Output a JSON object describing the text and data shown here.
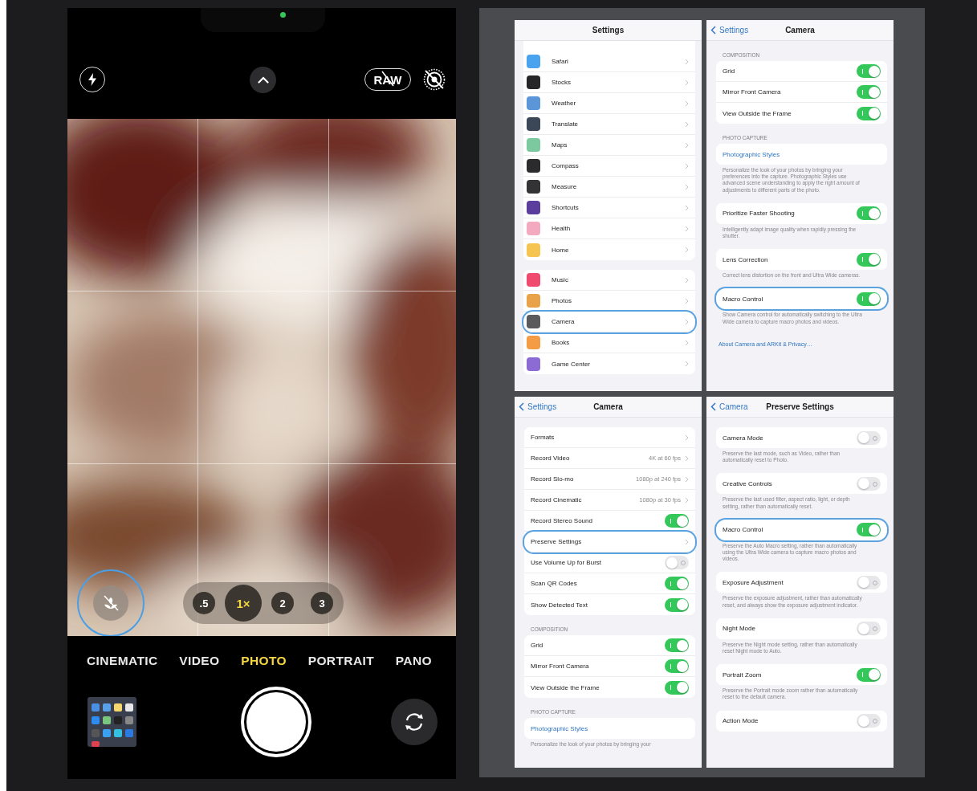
{
  "camera": {
    "raw_label": "RAW",
    "macro_highlighted": true,
    "zoom": [
      {
        "label": ".5",
        "selected": false
      },
      {
        "label": "1×",
        "selected": true
      },
      {
        "label": "2",
        "selected": false
      },
      {
        "label": "3",
        "selected": false
      }
    ],
    "modes": [
      {
        "label": "CINEMATIC",
        "selected": false
      },
      {
        "label": "VIDEO",
        "selected": false
      },
      {
        "label": "PHOTO",
        "selected": true
      },
      {
        "label": "PORTRAIT",
        "selected": false
      },
      {
        "label": "PANO",
        "selected": false
      }
    ]
  },
  "panels": [
    {
      "title": "Settings",
      "groups": [
        {
          "rows": [
            {
              "kind": "app",
              "label": "Safari",
              "color": "#4aa3ee",
              "highlighted": false
            },
            {
              "kind": "app",
              "label": "Stocks",
              "color": "#262628",
              "highlighted": false
            },
            {
              "kind": "app",
              "label": "Weather",
              "color": "#5b97d8",
              "highlighted": false
            },
            {
              "kind": "app",
              "label": "Translate",
              "color": "#3b4656",
              "highlighted": false
            },
            {
              "kind": "app",
              "label": "Maps",
              "color": "#7cc9a0",
              "highlighted": false
            },
            {
              "kind": "app",
              "label": "Compass",
              "color": "#2b2b2d",
              "highlighted": false
            },
            {
              "kind": "app",
              "label": "Measure",
              "color": "#333335",
              "highlighted": false
            },
            {
              "kind": "app",
              "label": "Shortcuts",
              "color": "#5b3d9e",
              "highlighted": false
            },
            {
              "kind": "app",
              "label": "Health",
              "color": "#f3a9c0",
              "highlighted": false
            },
            {
              "kind": "app",
              "label": "Home",
              "color": "#f5c451",
              "highlighted": false
            }
          ]
        },
        {
          "rows": [
            {
              "kind": "app",
              "label": "Music",
              "color": "#f04a6e",
              "highlighted": false
            },
            {
              "kind": "app",
              "label": "Photos",
              "color": "#e9a24a",
              "highlighted": false
            },
            {
              "kind": "app",
              "label": "Camera",
              "color": "#5a5a5c",
              "highlighted": true
            },
            {
              "kind": "app",
              "label": "Books",
              "color": "#f39c45",
              "highlighted": false
            },
            {
              "kind": "app",
              "label": "Game Center",
              "color": "#8c6cd4",
              "highlighted": false
            }
          ]
        }
      ]
    },
    {
      "back": "Settings",
      "title": "Camera",
      "groups": [
        {
          "header": "COMPOSITION",
          "rows": [
            {
              "kind": "toggle",
              "label": "Grid",
              "on": true,
              "highlighted": false
            },
            {
              "kind": "toggle",
              "label": "Mirror Front Camera",
              "on": true,
              "highlighted": false
            },
            {
              "kind": "toggle",
              "label": "View Outside the Frame",
              "on": true,
              "highlighted": false
            }
          ]
        },
        {
          "header": "PHOTO CAPTURE",
          "rows": [
            {
              "kind": "action",
              "label": "Photographic Styles",
              "highlighted": false
            }
          ],
          "footer": "Personalize the look of your photos by bringing your preferences into the capture. Photographic Styles use advanced scene understanding to apply the right amount of adjustments to different parts of the photo."
        },
        {
          "rows": [
            {
              "kind": "toggle",
              "label": "Prioritize Faster Shooting",
              "on": true,
              "highlighted": false
            }
          ],
          "footer": "Intelligently adapt image quality when rapidly pressing the shutter."
        },
        {
          "rows": [
            {
              "kind": "toggle",
              "label": "Lens Correction",
              "on": true,
              "highlighted": false
            }
          ],
          "footer": "Correct lens distortion on the front and Ultra Wide cameras."
        },
        {
          "rows": [
            {
              "kind": "toggle",
              "label": "Macro Control",
              "on": true,
              "highlighted": true
            }
          ],
          "footer": "Show Camera control for automatically switching to the Ultra Wide camera to capture macro photos and videos."
        }
      ],
      "link": "About Camera and ARKit & Privacy…"
    },
    {
      "back": "Settings",
      "title": "Camera",
      "groups": [
        {
          "rows": [
            {
              "kind": "chevron",
              "label": "Formats",
              "highlighted": false
            },
            {
              "kind": "chevron",
              "label": "Record Video",
              "value": "4K at 60 fps",
              "highlighted": false
            },
            {
              "kind": "chevron",
              "label": "Record Slo-mo",
              "value": "1080p at 240 fps",
              "highlighted": false
            },
            {
              "kind": "chevron",
              "label": "Record Cinematic",
              "value": "1080p at 30 fps",
              "highlighted": false
            },
            {
              "kind": "toggle",
              "label": "Record Stereo Sound",
              "on": true,
              "highlighted": false
            },
            {
              "kind": "chevron",
              "label": "Preserve Settings",
              "highlighted": true
            },
            {
              "kind": "toggle",
              "label": "Use Volume Up for Burst",
              "on": false,
              "highlighted": false
            },
            {
              "kind": "toggle",
              "label": "Scan QR Codes",
              "on": true,
              "highlighted": false
            },
            {
              "kind": "toggle",
              "label": "Show Detected Text",
              "on": true,
              "highlighted": false
            }
          ]
        },
        {
          "header": "COMPOSITION",
          "rows": [
            {
              "kind": "toggle",
              "label": "Grid",
              "on": true,
              "highlighted": false
            },
            {
              "kind": "toggle",
              "label": "Mirror Front Camera",
              "on": true,
              "highlighted": false
            },
            {
              "kind": "toggle",
              "label": "View Outside the Frame",
              "on": true,
              "highlighted": false
            }
          ]
        },
        {
          "header": "PHOTO CAPTURE",
          "rows": [
            {
              "kind": "action",
              "label": "Photographic Styles",
              "highlighted": false
            }
          ],
          "footer": "Personalize the look of your photos by bringing your"
        }
      ]
    },
    {
      "back": "Camera",
      "title": "Preserve Settings",
      "groups": [
        {
          "rows": [
            {
              "kind": "toggle",
              "label": "Camera Mode",
              "on": false,
              "highlighted": false
            }
          ],
          "footer": "Preserve the last mode, such as Video, rather than automatically reset to Photo."
        },
        {
          "rows": [
            {
              "kind": "toggle",
              "label": "Creative Controls",
              "on": false,
              "highlighted": false
            }
          ],
          "footer": "Preserve the last used filter, aspect ratio, light, or depth setting, rather than automatically reset."
        },
        {
          "rows": [
            {
              "kind": "toggle",
              "label": "Macro Control",
              "on": true,
              "highlighted": true
            }
          ],
          "footer": "Preserve the Auto Macro setting, rather than automatically using the Ultra Wide camera to capture macro photos and videos."
        },
        {
          "rows": [
            {
              "kind": "toggle",
              "label": "Exposure Adjustment",
              "on": false,
              "highlighted": false
            }
          ],
          "footer": "Preserve the exposure adjustment, rather than automatically reset, and always show the exposure adjustment indicator."
        },
        {
          "rows": [
            {
              "kind": "toggle",
              "label": "Night Mode",
              "on": false,
              "highlighted": false
            }
          ],
          "footer": "Preserve the Night mode setting, rather than automatically reset Night mode to Auto."
        },
        {
          "rows": [
            {
              "kind": "toggle",
              "label": "Portrait Zoom",
              "on": true,
              "highlighted": false
            }
          ],
          "footer": "Preserve the Portrait mode zoom rather than automatically reset to the default camera."
        },
        {
          "rows": [
            {
              "kind": "toggle",
              "label": "Action Mode",
              "on": false,
              "highlighted": false
            }
          ]
        }
      ]
    }
  ]
}
